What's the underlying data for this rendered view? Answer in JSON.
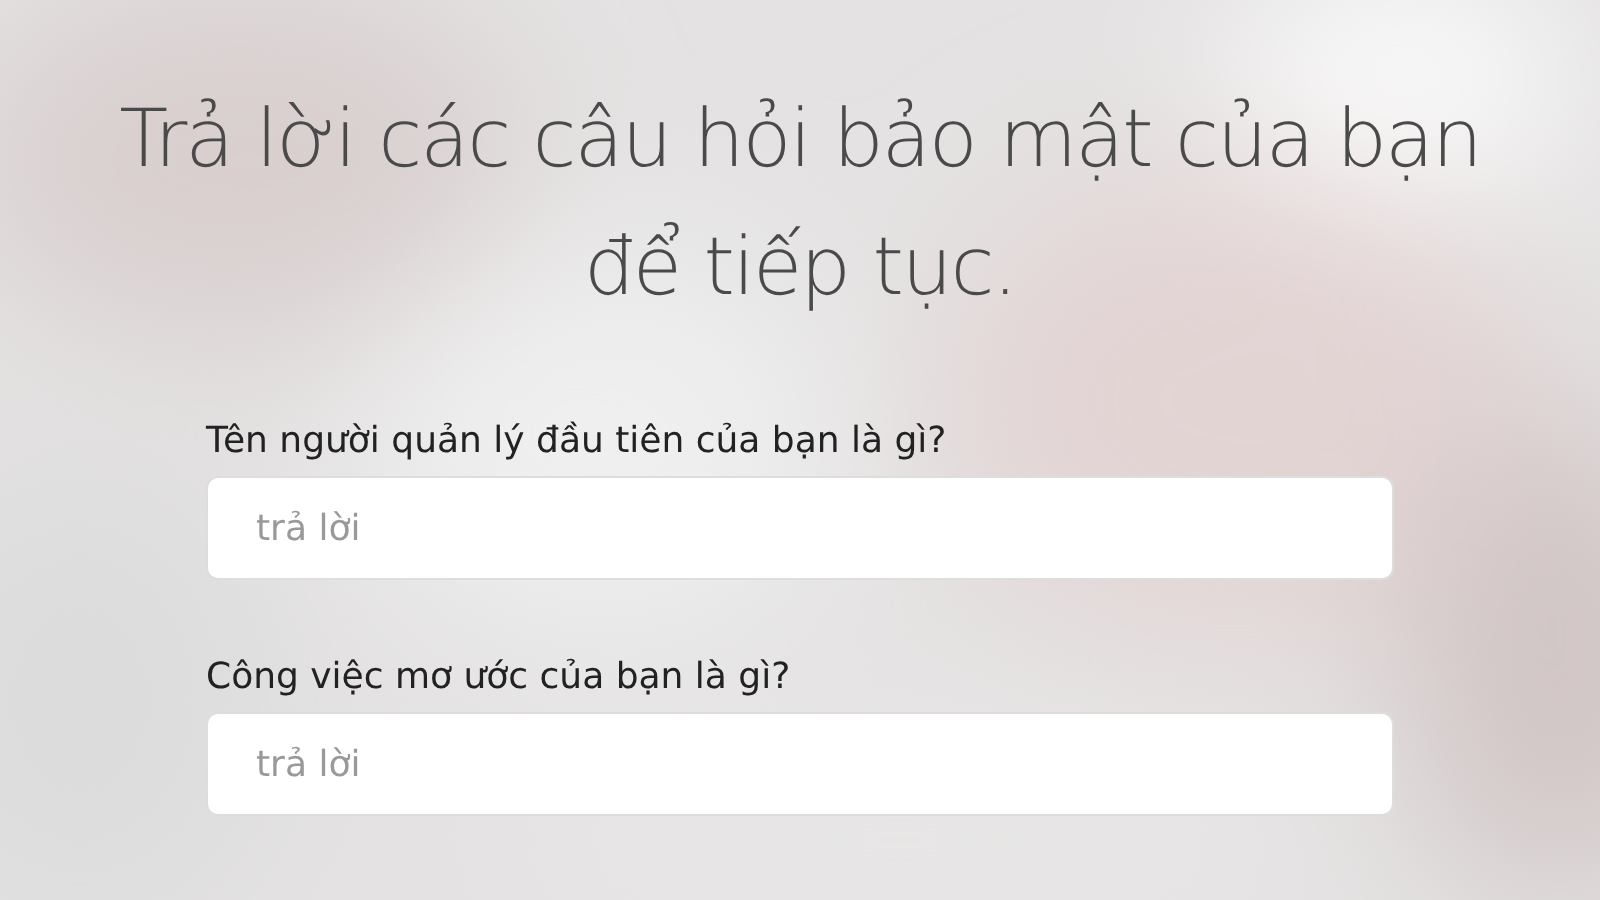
{
  "heading": "Trả lời các câu hỏi bảo mật của bạn để tiếp tục.",
  "questions": [
    {
      "label": "Tên người quản lý đầu tiên của bạn là gì?",
      "placeholder": "trả lời"
    },
    {
      "label": "Công việc mơ ước của bạn là gì?",
      "placeholder": "trả lời"
    }
  ]
}
